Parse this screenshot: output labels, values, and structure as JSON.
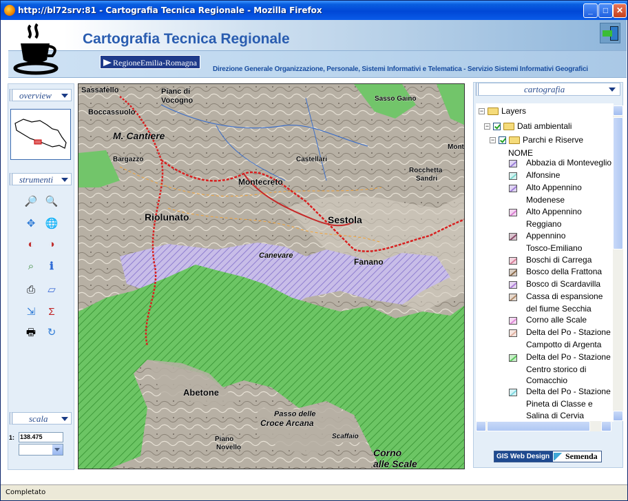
{
  "window": {
    "title": "http://bl72srv:81 - Cartografia Tecnica Regionale - Mozilla Firefox"
  },
  "header": {
    "title": "Cartografia Tecnica Regionale",
    "region_logo": "RegioneEmilia-Romagna",
    "department": "Direzione Generale Organizzazione, Personale, Sistemi Informativi e Telematica - Servizio Sistemi Informativi Geografici"
  },
  "left": {
    "overview_title": "overview",
    "tools_title": "strumenti",
    "scale_title": "scala",
    "scale_prefix": "1:",
    "scale_value": "138.475"
  },
  "tools": [
    "zoom-in-icon",
    "zoom-out-icon",
    "pan-icon",
    "full-extent-icon",
    "previous-extent-icon",
    "next-extent-icon",
    "select-icon",
    "info-icon",
    "print-setup-icon",
    "eraser-icon",
    "export-icon",
    "measure-icon",
    "print-icon",
    "refresh-icon"
  ],
  "map": {
    "labels": [
      "Sassafello",
      "Pianc di",
      "Vocogno",
      "Boccassuolo",
      "M. Cantiere",
      "Bargazzo",
      "Rocchetta",
      "Sandri",
      "Castellari",
      "Montecreto",
      "Sestola",
      "Riolunato",
      "Fanano",
      "Canevare",
      "Abetone",
      "Piano",
      "Novello",
      "Passo delle",
      "Croce Arcana",
      "Scaffaio",
      "Corno",
      "alle Scale",
      "Sasso Gaino",
      "Monte"
    ]
  },
  "right": {
    "title": "cartografia",
    "tree": {
      "root": "Layers",
      "group": "Dati ambientali",
      "subgroup": "Parchi e Riserve",
      "field": "NOME",
      "items": [
        {
          "label": "Abbazia di Monteveglio",
          "color": "#9b7fd8"
        },
        {
          "label": "Alfonsine",
          "color": "#7fd8d0"
        },
        {
          "label": "Alto Appennino",
          "color": "#a07fd8"
        },
        {
          "label": "Modenese",
          "color": ""
        },
        {
          "label": "Alto Appennino",
          "color": "#d87fd0"
        },
        {
          "label": "Reggiano",
          "color": ""
        },
        {
          "label": "Appennino",
          "color": "#8a4a6a"
        },
        {
          "label": "Tosco-Emiliano",
          "color": ""
        },
        {
          "label": "Boschi di Carrega",
          "color": "#d87f9b"
        },
        {
          "label": "Bosco della Frattona",
          "color": "#8a6a4a"
        },
        {
          "label": "Bosco di Scardavilla",
          "color": "#b07fd8"
        },
        {
          "label": "Cassa di espansione",
          "color": "#b08a6a"
        },
        {
          "label": "del fiume Secchia",
          "color": ""
        },
        {
          "label": "Corno alle Scale",
          "color": "#e08ad8"
        },
        {
          "label": "Delta del Po - Stazione",
          "color": "#e0b0a0"
        },
        {
          "label": "Campotto di Argenta",
          "color": ""
        },
        {
          "label": "Delta del Po - Stazione",
          "color": "#5cc85c"
        },
        {
          "label": "Centro storico di",
          "color": ""
        },
        {
          "label": "Comacchio",
          "color": ""
        },
        {
          "label": "Delta del Po - Stazione",
          "color": "#7fd8e0"
        },
        {
          "label": "Pineta di Classe e",
          "color": ""
        },
        {
          "label": "Salina di Cervia",
          "color": ""
        }
      ]
    },
    "badge_left": "GIS Web Design",
    "badge_right": "Semenda"
  },
  "status": {
    "text": "Completato"
  },
  "colors": {
    "accent": "#2a5db0",
    "park_green": "#5ec25a",
    "park_purple": "#b6a8e6",
    "route_red": "#d81e1e"
  }
}
